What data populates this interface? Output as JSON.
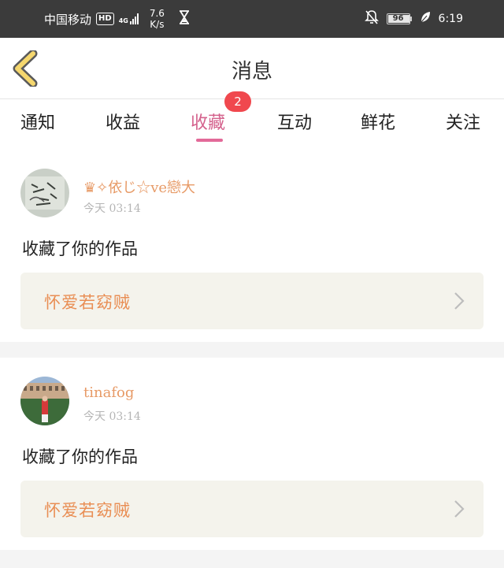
{
  "status_bar": {
    "carrier": "中国移动",
    "hd": "HD",
    "network": "4G",
    "speed_value": "7.6",
    "speed_unit": "K/s",
    "battery": "96",
    "time": "6:19"
  },
  "header": {
    "title": "消息"
  },
  "tabs": [
    {
      "label": "通知",
      "active": false
    },
    {
      "label": "收益",
      "active": false
    },
    {
      "label": "收藏",
      "active": true,
      "badge": "2"
    },
    {
      "label": "互动",
      "active": false
    },
    {
      "label": "鲜花",
      "active": false
    },
    {
      "label": "关注",
      "active": false
    }
  ],
  "notifications": [
    {
      "username": "♛✧依じ☆ve戀大",
      "time": "今天 03:14",
      "action": "收藏了你的作品",
      "work_title": "怀爱若窈贼"
    },
    {
      "username": "tinafog",
      "time": "今天 03:14",
      "action": "收藏了你的作品",
      "work_title": "怀爱若窈贼"
    }
  ],
  "colors": {
    "accent": "#e36a99",
    "username": "#e79a66",
    "work_title": "#e98e54",
    "badge": "#f0484e",
    "back_arrow": "#f5d76e"
  }
}
